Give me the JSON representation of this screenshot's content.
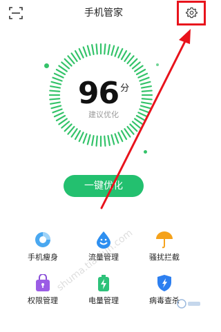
{
  "header": {
    "title": "手机管家",
    "left_icon": "scan-icon",
    "right_icon": "gear-icon"
  },
  "score": {
    "value": "96",
    "unit": "分",
    "label": "建议优化"
  },
  "optimize_button": {
    "label": "一键优化"
  },
  "tools": [
    {
      "label": "手机瘦身",
      "icon": "pie-chart-icon"
    },
    {
      "label": "流量管理",
      "icon": "water-drop-icon"
    },
    {
      "label": "骚扰拦截",
      "icon": "umbrella-icon"
    },
    {
      "label": "权限管理",
      "icon": "lock-bag-icon"
    },
    {
      "label": "电量管理",
      "icon": "battery-icon"
    },
    {
      "label": "病毒查杀",
      "icon": "shield-icon"
    }
  ],
  "watermark": {
    "url_text": "shuma.tianjun.com"
  },
  "colors": {
    "accent_green": "#23c06f",
    "ring_green": "#34c36a",
    "annotation_red": "#e8131c"
  }
}
